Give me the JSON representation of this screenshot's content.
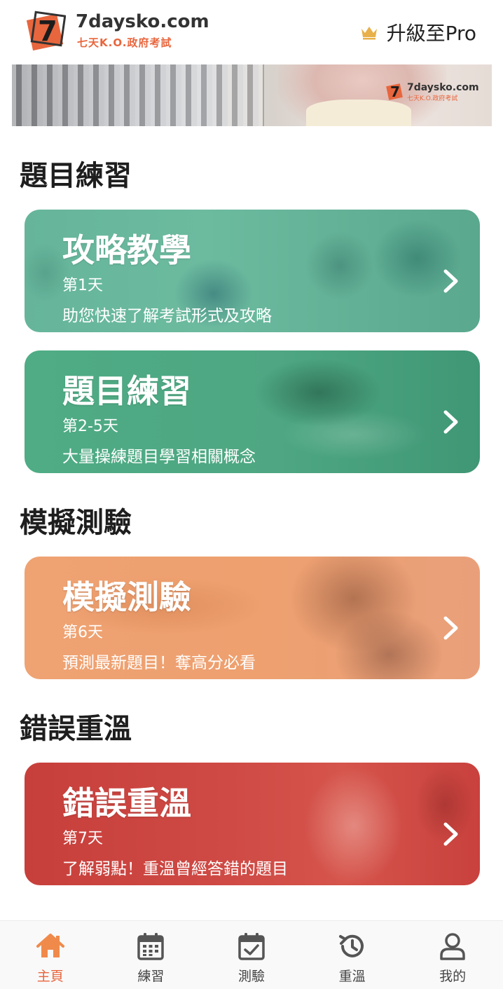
{
  "header": {
    "logo_text": "7",
    "brand_name": "7daysko.com",
    "brand_sub": "七天K.O.政府考試",
    "upgrade_label": "升級至Pro"
  },
  "banner": {
    "logo_name": "7daysko.com",
    "logo_sub": "七天K.O.政府考試"
  },
  "sections": [
    {
      "title": "題目練習",
      "cards": [
        {
          "title": "攻略教學",
          "day": "第1天",
          "desc": "助您快速了解考試形式及攻略"
        },
        {
          "title": "題目練習",
          "day": "第2-5天",
          "desc": "大量操練題目學習相關概念"
        }
      ]
    },
    {
      "title": "模擬測驗",
      "cards": [
        {
          "title": "模擬測驗",
          "day": "第6天",
          "desc": "預測最新題目！奪高分必看"
        }
      ]
    },
    {
      "title": "錯誤重溫",
      "cards": [
        {
          "title": "錯誤重溫",
          "day": "第7天",
          "desc": "了解弱點！重溫曾經答錯的題目"
        }
      ]
    }
  ],
  "bottom_nav": {
    "items": [
      {
        "label": "主頁",
        "icon": "home-icon",
        "active": true
      },
      {
        "label": "練習",
        "icon": "calendar-icon",
        "active": false
      },
      {
        "label": "測驗",
        "icon": "calendar-check-icon",
        "active": false
      },
      {
        "label": "重溫",
        "icon": "history-icon",
        "active": false
      },
      {
        "label": "我的",
        "icon": "user-icon",
        "active": false
      }
    ]
  },
  "colors": {
    "accent": "#e8663d",
    "active_nav": "#f08a4b",
    "inactive_nav": "#555555",
    "card_teal": "#66b59b",
    "card_green": "#4fac85",
    "card_orange": "#efa272",
    "card_red": "#cf4a45",
    "crown": "#e8b04a"
  }
}
